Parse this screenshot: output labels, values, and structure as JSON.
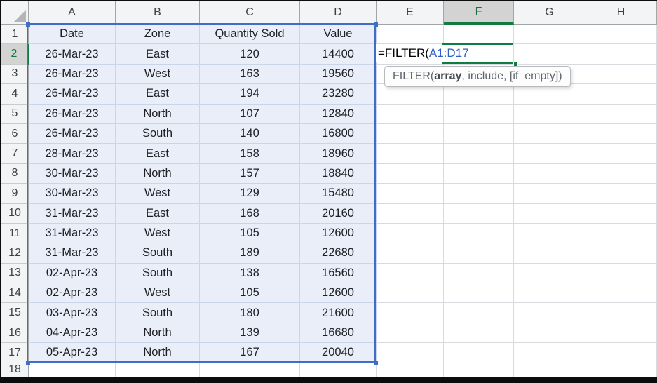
{
  "app": {
    "description": "Excel worksheet with FILTER formula being entered"
  },
  "column_headers": [
    "A",
    "B",
    "C",
    "D",
    "E",
    "F",
    "G",
    "H"
  ],
  "row_numbers": [
    "1",
    "2",
    "3",
    "4",
    "5",
    "6",
    "7",
    "8",
    "9",
    "10",
    "11",
    "12",
    "13",
    "14",
    "15",
    "16",
    "17",
    "18"
  ],
  "active_cell": {
    "column": "F",
    "row": "2"
  },
  "formula": {
    "prefix": "=FILTER(",
    "reference": "A1:D17"
  },
  "tooltip": {
    "signature_prefix": "FILTER(",
    "active_arg": "array",
    "signature_suffix": ", include, [if_empty])"
  },
  "table": {
    "range": "A1:D17",
    "headers": [
      "Date",
      "Zone",
      "Quantity Sold",
      "Value"
    ],
    "rows": [
      [
        "26-Mar-23",
        "East",
        "120",
        "14400"
      ],
      [
        "26-Mar-23",
        "West",
        "163",
        "19560"
      ],
      [
        "26-Mar-23",
        "East",
        "194",
        "23280"
      ],
      [
        "26-Mar-23",
        "North",
        "107",
        "12840"
      ],
      [
        "26-Mar-23",
        "South",
        "140",
        "16800"
      ],
      [
        "28-Mar-23",
        "East",
        "158",
        "18960"
      ],
      [
        "30-Mar-23",
        "North",
        "157",
        "18840"
      ],
      [
        "30-Mar-23",
        "West",
        "129",
        "15480"
      ],
      [
        "31-Mar-23",
        "East",
        "168",
        "20160"
      ],
      [
        "31-Mar-23",
        "West",
        "105",
        "12600"
      ],
      [
        "31-Mar-23",
        "South",
        "189",
        "22680"
      ],
      [
        "02-Apr-23",
        "South",
        "138",
        "16560"
      ],
      [
        "02-Apr-23",
        "West",
        "105",
        "12600"
      ],
      [
        "03-Apr-23",
        "South",
        "180",
        "21600"
      ],
      [
        "04-Apr-23",
        "North",
        "139",
        "16680"
      ],
      [
        "05-Apr-23",
        "North",
        "167",
        "20040"
      ]
    ]
  },
  "colors": {
    "accent_green": "#107c41",
    "range_highlight_fill": "#e9eef8",
    "range_marquee_blue": "#3e6ec5",
    "reference_text_blue": "#2e5fc7",
    "selected_header_bg": "#d3d3d3",
    "gridline": "#d7dadf"
  }
}
